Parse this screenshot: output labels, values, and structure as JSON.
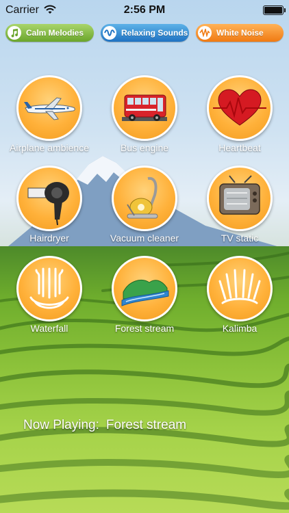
{
  "status": {
    "carrier": "Carrier",
    "time": "2:56 PM"
  },
  "categories": [
    {
      "label": "Calm Melodies",
      "icon": "music-note-icon",
      "color": "#7fb93a"
    },
    {
      "label": "Relaxing Sounds",
      "icon": "sound-wave-icon",
      "color": "#2e86d6"
    },
    {
      "label": "White Noise",
      "icon": "wave-icon",
      "color": "#f48a1e"
    }
  ],
  "sounds": [
    {
      "label": "Airplane ambience",
      "icon": "airplane-icon"
    },
    {
      "label": "Bus engine",
      "icon": "bus-icon"
    },
    {
      "label": "Heartbeat",
      "icon": "heart-icon"
    },
    {
      "label": "Hairdryer",
      "icon": "hairdryer-icon"
    },
    {
      "label": "Vacuum cleaner",
      "icon": "vacuum-icon"
    },
    {
      "label": "TV static",
      "icon": "tv-icon"
    },
    {
      "label": "Waterfall",
      "icon": "waterfall-icon"
    },
    {
      "label": "Forest stream",
      "icon": "stream-icon"
    },
    {
      "label": "Kalimba",
      "icon": "kalimba-icon"
    }
  ],
  "now_playing": {
    "prefix": "Now Playing:",
    "title": "Forest stream"
  }
}
